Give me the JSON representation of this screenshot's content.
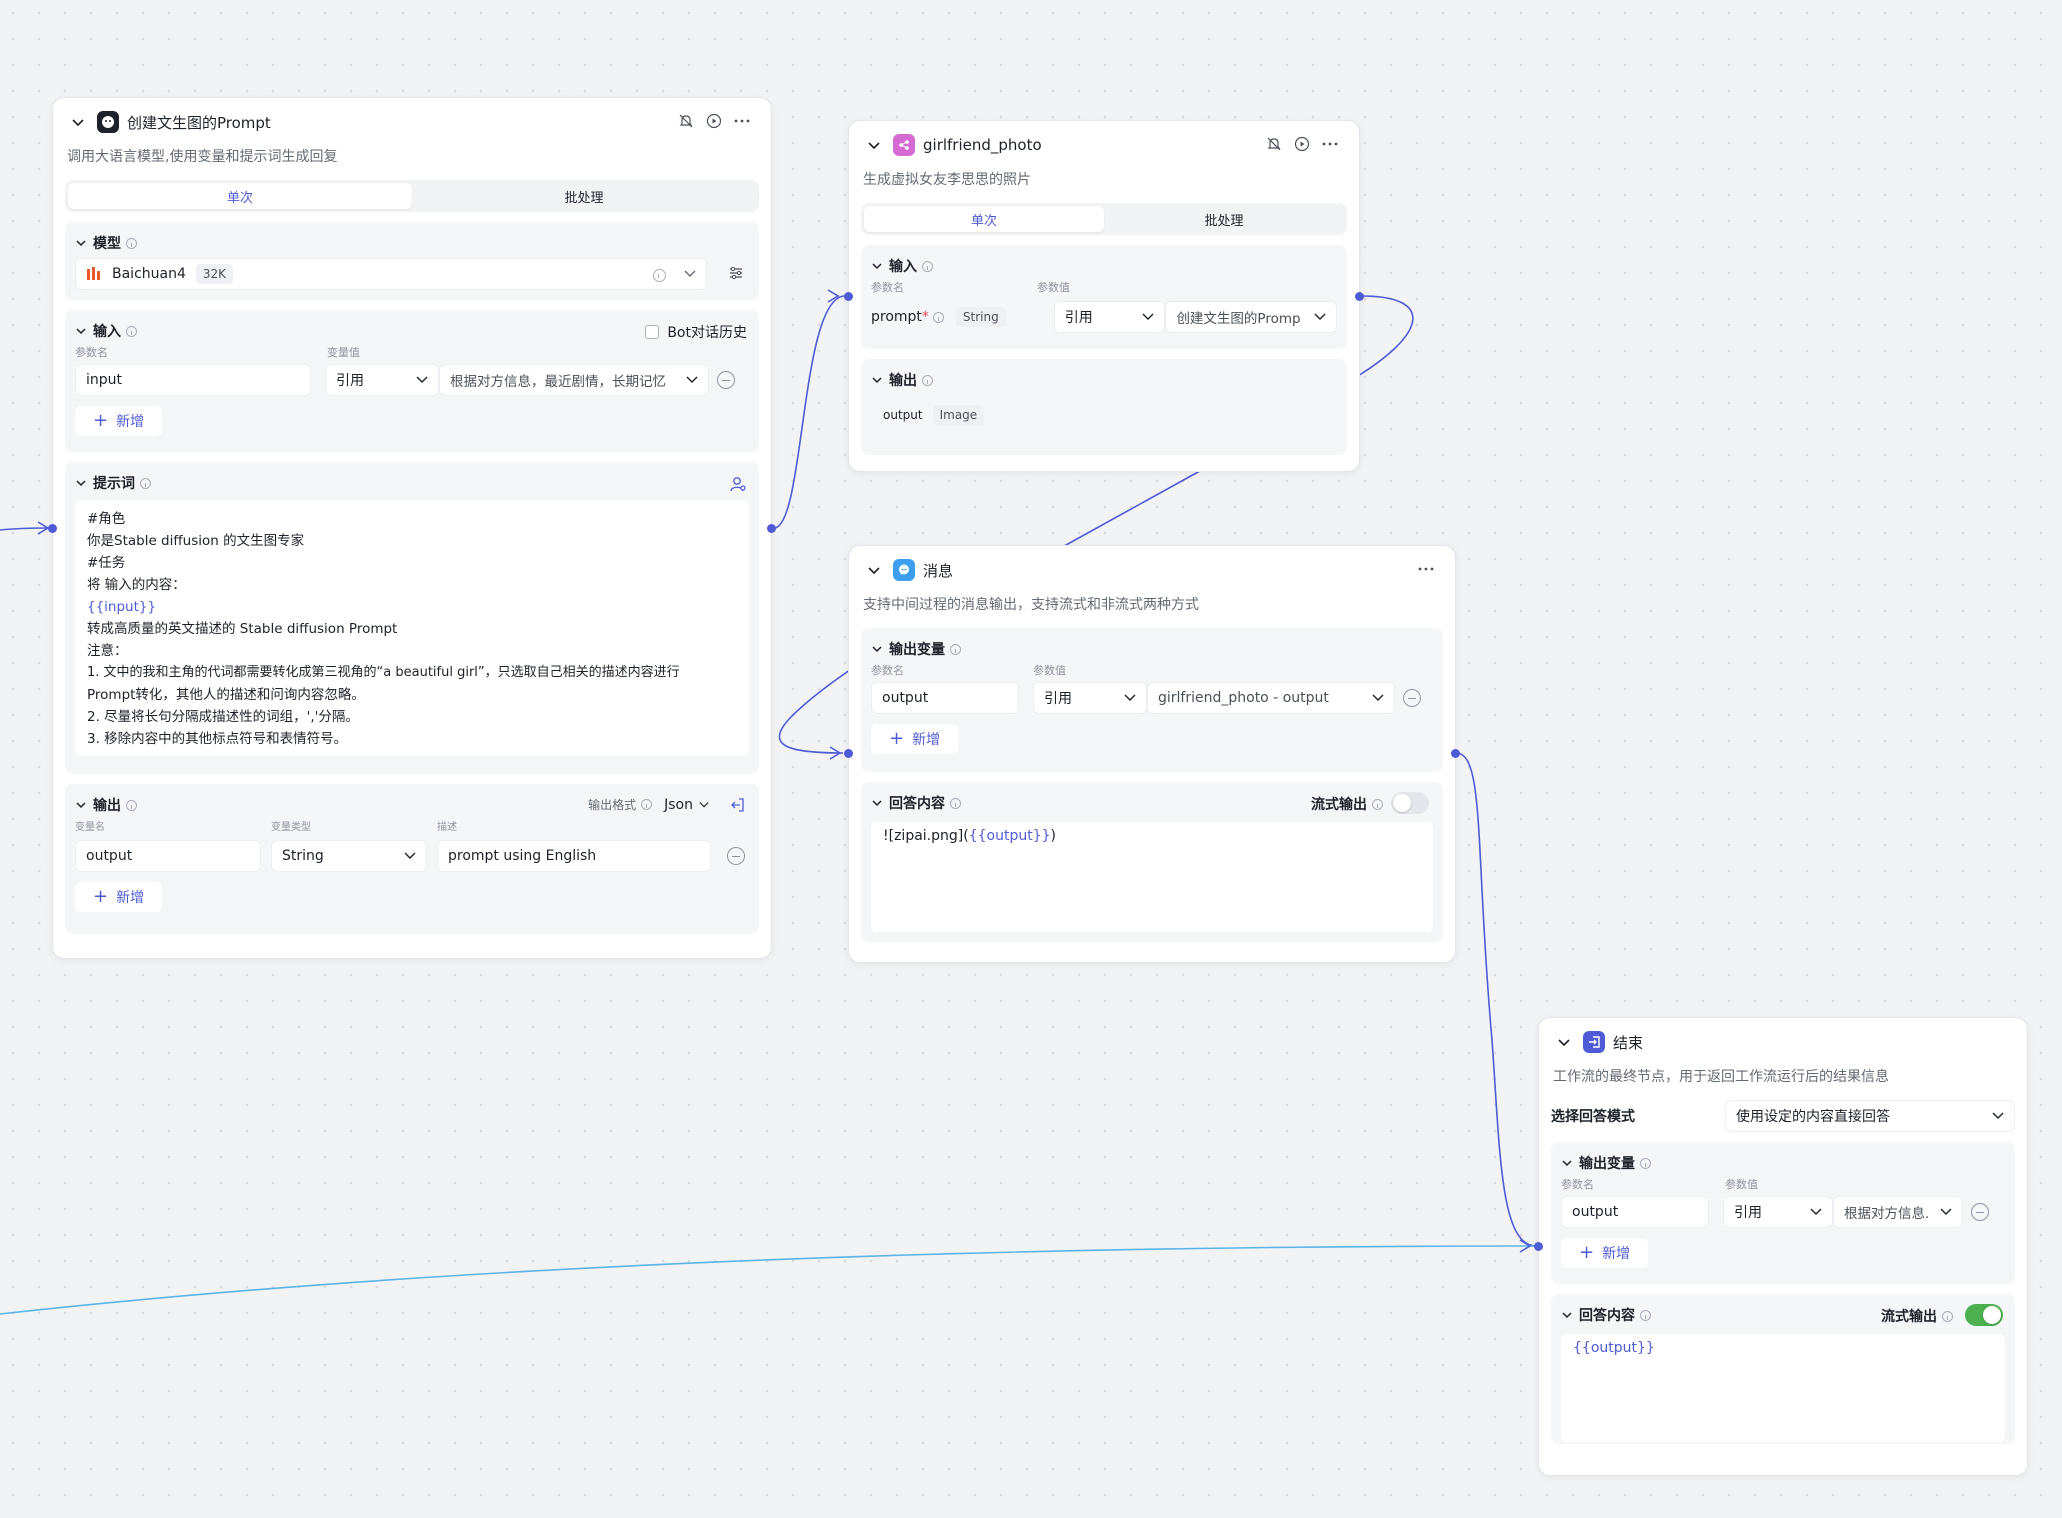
{
  "llm_node": {
    "title": "创建文生图的Prompt",
    "desc": "调用大语言模型,使用变量和提示词生成回复",
    "tabs": [
      "单次",
      "批处理"
    ],
    "model_label": "模型",
    "model_name": "Baichuan4",
    "model_ctx": "32K",
    "input_label": "输入",
    "bot_history_label": "Bot对话历史",
    "param_name_label": "参数名",
    "var_value_label": "变量值",
    "input_name": "input",
    "input_type": "引用",
    "input_ref": "根据对方信息，最近剧情，长期记忆",
    "add_label": "新增",
    "prompt_label": "提示词",
    "prompt_lines": [
      "#角色",
      "你是Stable diffusion 的文生图专家",
      "#任务",
      "将 输入的内容：",
      "{{input}}",
      "转成高质量的英文描述的 Stable diffusion Prompt",
      "注意：",
      "1. 文中的我和主角的代词都需要转化成第三视角的“a beautiful girl”，只选取自己相关的描述内容进行",
      "Prompt转化，其他人的描述和问询内容忽略。",
      "2. 尽量将长句分隔成描述性的词组，','分隔。",
      "3. 移除内容中的其他标点符号和表情符号。"
    ],
    "output_label": "输出",
    "output_format_label": "输出格式",
    "output_format": "Json",
    "col_var_name": "变量名",
    "col_var_type": "变量类型",
    "col_desc": "描述",
    "out_name": "output",
    "out_type": "String",
    "out_desc": "prompt using English"
  },
  "photo_node": {
    "title": "girlfriend_photo",
    "desc": "生成虚拟女友李思思的照片",
    "tabs": [
      "单次",
      "批处理"
    ],
    "input_label": "输入",
    "param_name_label": "参数名",
    "param_value_label": "参数值",
    "param_name": "prompt",
    "required_mark": "*",
    "param_type": "String",
    "ref_type": "引用",
    "ref_value": "创建文生图的Promp",
    "output_label": "输出",
    "out_name": "output",
    "out_type": "Image"
  },
  "msg_node": {
    "title": "消息",
    "desc": "支持中间过程的消息输出，支持流式和非流式两种方式",
    "out_var_label": "输出变量",
    "param_name_label": "参数名",
    "param_value_label": "参数值",
    "var_name": "output",
    "ref_type": "引用",
    "ref_value": "girlfriend_photo - output",
    "add_label": "新增",
    "answer_label": "回答内容",
    "stream_label": "流式输出",
    "stream_on": false,
    "answer_prefix": "![zipai.png](",
    "answer_var": "{{output}}",
    "answer_suffix": ")"
  },
  "end_node": {
    "title": "结束",
    "desc": "工作流的最终节点，用于返回工作流运行后的结果信息",
    "mode_label": "选择回答模式",
    "mode_value": "使用设定的内容直接回答",
    "out_var_label": "输出变量",
    "param_name_label": "参数名",
    "param_value_label": "参数值",
    "var_name": "output",
    "ref_type": "引用",
    "ref_value": "根据对方信息.",
    "add_label": "新增",
    "answer_label": "回答内容",
    "stream_label": "流式输出",
    "stream_on": true,
    "answer_var": "{{output}}"
  },
  "colors": {
    "accent": "#4e5bd6",
    "edge": "#4e5bd6",
    "edge_light": "#5ab4e6",
    "toggle_on": "#4cb050",
    "canvas": "#f2f3f5"
  }
}
